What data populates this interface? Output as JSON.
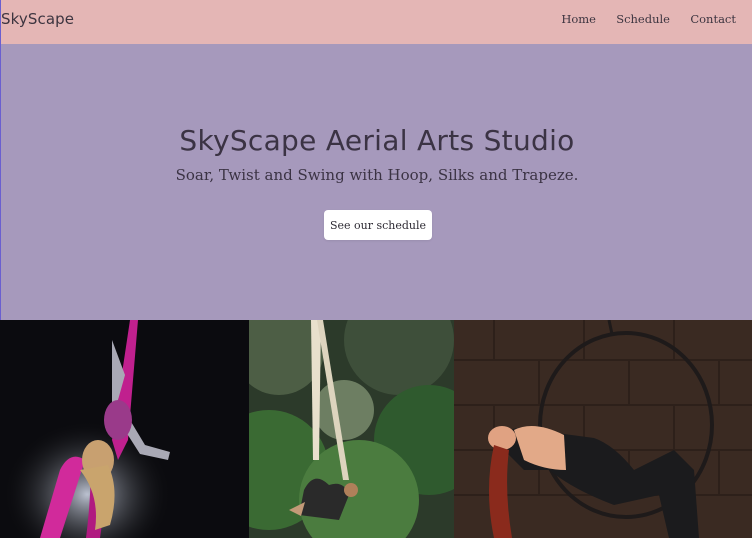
{
  "navbar": {
    "brand": "SkyScape",
    "links": [
      {
        "label": "Home"
      },
      {
        "label": "Schedule"
      },
      {
        "label": "Contact"
      }
    ]
  },
  "hero": {
    "title": "SkyScape Aerial Arts Studio",
    "subtitle": "Soar, Twist and Swing with Hoop, Silks and Trapeze.",
    "button_label": "See our schedule"
  },
  "colors": {
    "navbar_bg": "#e4b6b5",
    "hero_bg": "#a699bc",
    "text": "#3b3344",
    "button_bg": "#ffffff"
  }
}
